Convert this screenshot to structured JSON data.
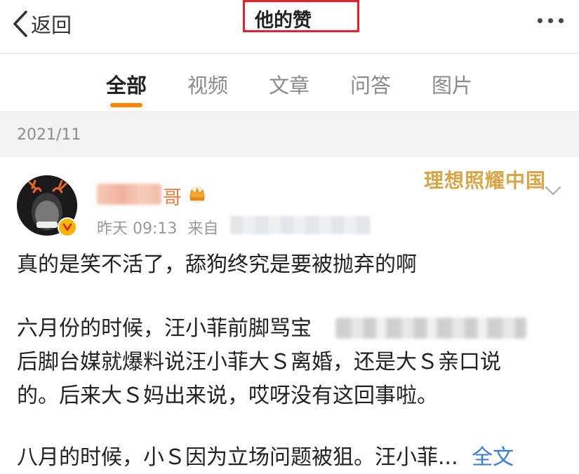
{
  "nav": {
    "back_label": "返回",
    "title": "他的赞"
  },
  "tabs": [
    {
      "label": "全部",
      "active": true
    },
    {
      "label": "视频",
      "active": false
    },
    {
      "label": "文章",
      "active": false
    },
    {
      "label": "问答",
      "active": false
    },
    {
      "label": "图片",
      "active": false
    }
  ],
  "date_group": "2021/11",
  "post": {
    "username_visible": "哥",
    "time": "昨天 09:13",
    "source_prefix": "来自",
    "slogan": "理想照耀中国",
    "lines": [
      "真的是笑不活了，舔狗终究是要被抛弃的啊",
      "六月份的时候，汪小菲前脚骂宝",
      "后脚台媒就爆料说汪小菲大Ｓ离婚，还是大Ｓ亲口说",
      "的。后来大Ｓ妈出来说，哎呀没有这回事啦。",
      "八月的时候，小Ｓ因为立场问题被狙。汪小菲..."
    ],
    "full_text_link": "全文"
  },
  "colors": {
    "accent_orange": "#ff8200",
    "highlight_red": "#e0222c",
    "link_blue": "#3a7bd5",
    "slogan_gold": "#d8a548"
  },
  "icons": [
    "chevron-left-icon",
    "more-icon",
    "crown-icon",
    "verified-icon",
    "chevron-down-icon"
  ]
}
